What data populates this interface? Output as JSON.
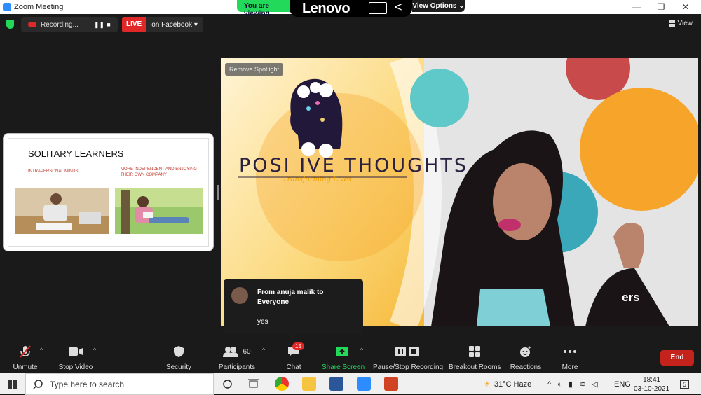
{
  "window": {
    "title": "Zoom Meeting",
    "min": "—",
    "max": "❐",
    "close": "✕"
  },
  "share_banner": {
    "status": "You are viewing",
    "brand": "Lenovo",
    "back": "<",
    "view_options": "View Options ⌄"
  },
  "recording": {
    "label": "Recording...",
    "pause": "❚❚",
    "stop": "■"
  },
  "live": {
    "tag": "LIVE",
    "destination": "on Facebook ▾"
  },
  "view_label": "View",
  "slide": {
    "title": "SOLITARY LEARNERS",
    "sub_left": "INTRAPERSONAL MINDS",
    "sub_right": "MORE INDEPENDENT AND ENJOYING THEIR OWN COMPANY"
  },
  "video": {
    "spotlight_button": "Remove Spotlight",
    "logo_title": "POSI IVE THOUGHTS",
    "logo_subtitle": "Transforming Lives",
    "corner_text": "ers"
  },
  "chat_popup": {
    "from": "From anuja malik to Everyone",
    "message": "yes"
  },
  "toolbar": {
    "unmute": "Unmute",
    "stop_video": "Stop Video",
    "security": "Security",
    "participants": "Participants",
    "participants_count": "60",
    "chat": "Chat",
    "chat_badge": "15",
    "share_screen": "Share Screen",
    "pause_stop_recording": "Pause/Stop Recording",
    "breakout_rooms": "Breakout Rooms",
    "reactions": "Reactions",
    "more": "More",
    "end": "End"
  },
  "taskbar": {
    "search_placeholder": "Type here to search",
    "weather": "31°C  Haze",
    "language": "ENG",
    "time": "18:41",
    "date": "03-10-2021",
    "notification_count": "5"
  },
  "colors": {
    "accent_green": "#23d959",
    "live_red": "#e02828",
    "end_red": "#c4231c",
    "zoom_blue": "#2d8cff"
  }
}
